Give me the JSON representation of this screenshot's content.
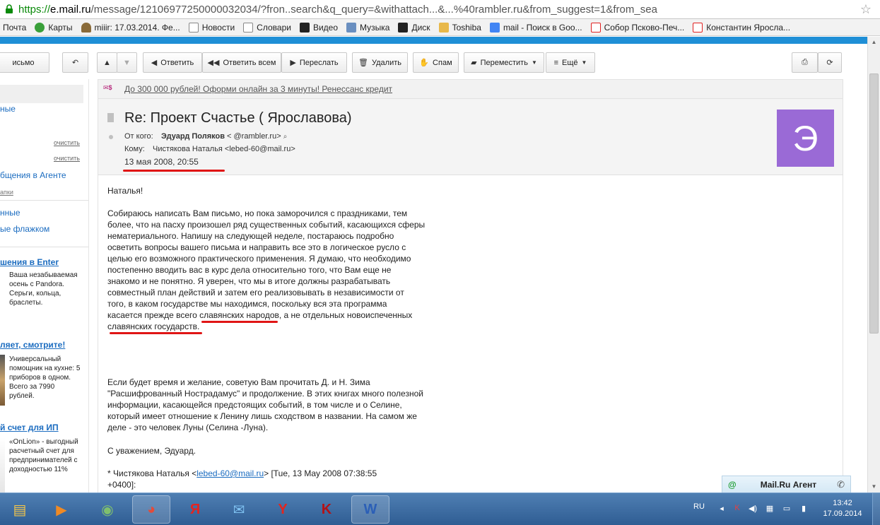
{
  "browser": {
    "url_scheme": "https://",
    "url_host": "e.mail.ru",
    "url_rest": "/message/12106977250000032034/?fron..search&q_query=&withattach...&...%40rambler.ru&from_suggest=1&from_sea"
  },
  "bookmarks": [
    {
      "label": "Почта",
      "icon": "mail-icon",
      "color": "#2c7bd1"
    },
    {
      "label": "Карты",
      "icon": "maps-icon",
      "color": "#3aa03a"
    },
    {
      "label": "miiir: 17.03.2014. Фе...",
      "icon": "user-icon",
      "color": "#8a6b3a"
    },
    {
      "label": "Новости",
      "icon": "page-icon",
      "color": "#888888"
    },
    {
      "label": "Словари",
      "icon": "page-icon",
      "color": "#888888"
    },
    {
      "label": "Видео",
      "icon": "play-icon",
      "color": "#222222"
    },
    {
      "label": "Музыка",
      "icon": "music-icon",
      "color": "#6a8fc0"
    },
    {
      "label": "Диск",
      "icon": "disk-icon",
      "color": "#222222"
    },
    {
      "label": "Toshiba",
      "icon": "folder-icon",
      "color": "#e8b84a"
    },
    {
      "label": "mail - Поиск в Goo...",
      "icon": "google-icon",
      "color": "#4285f4"
    },
    {
      "label": "Собор Псково-Печ...",
      "icon": "yandex-icon",
      "color": "#e02020"
    },
    {
      "label": "Константин Яросла...",
      "icon": "yandex-icon",
      "color": "#e02020"
    }
  ],
  "toolbar": {
    "write": "исьмо",
    "reply": "Ответить",
    "reply_all": "Ответить всем",
    "forward": "Переслать",
    "delete": "Удалить",
    "spam": "Спам",
    "move": "Переместить",
    "more": "Ещё"
  },
  "sidebar": {
    "link1": "ные",
    "clean1": "очистить",
    "clean2": "очистить",
    "agent_messages": "бщения в Агенте",
    "folders": "апки",
    "link2": "нные",
    "flagged": "ые флажком",
    "ads": [
      {
        "title": "шения в Enter",
        "text": "Ваша незабываемая осень с Pandora. Серьги, кольца, браслеты."
      },
      {
        "title": "ляет, смотрите!",
        "text": "Универсальный помощник на кухне: 5 приборов в одном. Всего за 7990 рублей."
      },
      {
        "title": "й счет для ИП",
        "text": "«OnLion» - выгодный расчетный счет для предпринимателей с доходностью 11%"
      }
    ]
  },
  "ad_banner": {
    "link": "До 300 000 рублей! Оформи онлайн за 3 минуты! Ренессанс кредит"
  },
  "message": {
    "subject": "Re: Проект Счастье ( Ярославова)",
    "from_label": "От кого:",
    "from_name": "Эдуард Поляков",
    "from_email": " <            @rambler.ru>",
    "to_label": "Кому:",
    "to": "Чистякова Наталья <lebed-60@mail.ru>",
    "date": "13 мая 2008, 20:55",
    "avatar_letter": "Э",
    "greeting": "Наталья!",
    "para1": [
      "Собираюсь написать Вам письмо, но пока заморочился с праздниками, тем",
      "более, что на пасху произошел ряд существенных событий, касающихся сферы",
      "нематериального. Напишу на следующей неделе, постараюсь подробно",
      "осветить вопросы вашего письма и направить все это в логическое русло с",
      "целью его возможного практического применения. Я думаю, что необходимо",
      "постепенно вводить вас в курс дела относительно того, что Вам еще не",
      "знакомо и не понятно. Я уверен, что мы в итоге должны разрабатывать",
      "совместный план действий и затем его реализовывать в независимости от",
      "того, в каком государстве мы находимся, поскольку вся эта программа",
      "касается прежде всего славянских народов, а не отдельных новоиспеченных",
      "славянских государств."
    ],
    "para2": [
      "Если будет время и желание, советую Вам прочитать Д. и Н. Зима",
      "\"Расшифрованный Нострадамус\" и продолжение. В этих книгах много полезной",
      "информации, касающейся предстоящих событий, в том числе и о Селине,",
      "который имеет отношение к Ленину лишь сходством в названии. На самом же",
      "деле - это человек Луны (Селина -Луна)."
    ],
    "signature": "С уважением, Эдуард.",
    "quote_prefix": "* Чистякова Наталья <",
    "quote_email": "lebed-60@mail.ru",
    "quote_suffix": "> [Tue, 13 May 2008 07:38:55",
    "quote_tz": "+0400]:"
  },
  "agent": {
    "title": "Mail.Ru Агент"
  },
  "taskbar": {
    "lang": "RU",
    "time": "13:42",
    "date": "17.09.2014"
  },
  "colors": {
    "link": "#1b6cc0",
    "accent_blue": "#1f8fd6",
    "avatar": "#9a6ad6",
    "annotation_red": "#e01515"
  }
}
